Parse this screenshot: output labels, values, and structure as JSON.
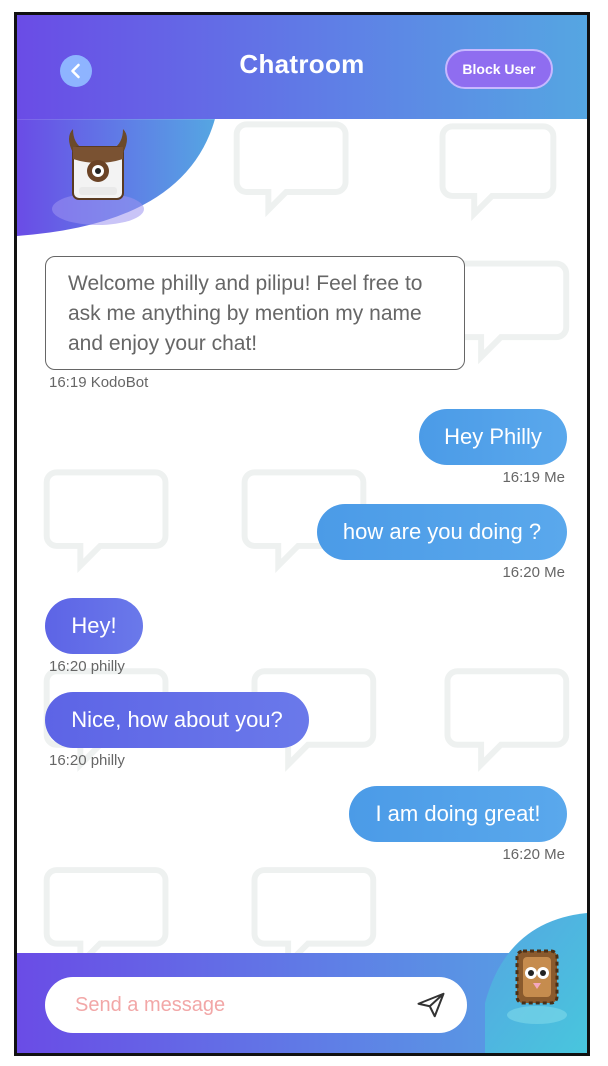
{
  "header": {
    "title": "Chatroom",
    "block_label": "Block User"
  },
  "messages": [
    {
      "text": "Welcome philly and pilipu! Feel free to ask me anything by mention my name and enjoy your chat!",
      "meta": "16:19 KodoBot"
    },
    {
      "text": "Hey Philly",
      "meta": "16:19 Me"
    },
    {
      "text": "how are you doing ?",
      "meta": "16:20 Me"
    },
    {
      "text": "Hey!",
      "meta": "16:20 philly"
    },
    {
      "text": "Nice, how about you?",
      "meta": "16:20 philly"
    },
    {
      "text": "I am doing great!",
      "meta": "16:20 Me"
    }
  ],
  "composer": {
    "placeholder": "Send a message",
    "value": ""
  },
  "icons": {
    "back": "back-arrow-icon",
    "send": "send-paper-plane-icon"
  },
  "colors": {
    "header_start": "#6a4ce6",
    "header_end": "#55a6e2",
    "me_bubble": "#4b9be7",
    "other_bubble": "#5d64e6"
  }
}
